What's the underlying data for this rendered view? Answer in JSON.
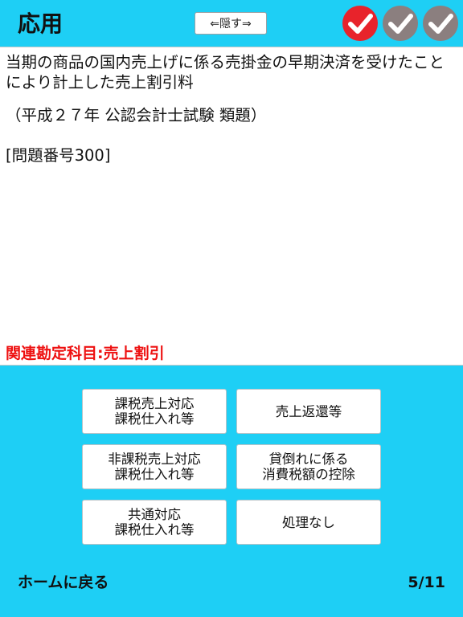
{
  "header": {
    "title": "応用",
    "hide_button_label": "⇐隠す⇒",
    "status_marks": [
      {
        "icon": "check-icon",
        "state": "correct",
        "color": "#e8232b"
      },
      {
        "icon": "check-icon",
        "state": "unanswered",
        "color": "#8b7f7f"
      },
      {
        "icon": "check-icon",
        "state": "unanswered",
        "color": "#8b7f7f"
      }
    ]
  },
  "question": {
    "text": "当期の商品の国内売上げに係る売掛金の早期決済を受けたことにより計上した売上割引料",
    "source": "（平成２７年 公認会計士試験 類題）",
    "number": "[問題番号300]",
    "related_subject": "関連勘定科目:売上割引",
    "related_color": "#ee1111"
  },
  "answers": [
    "課税売上対応\n課税仕入れ等",
    "売上返還等",
    "非課税売上対応\n課税仕入れ等",
    "貸倒れに係る\n消費税額の控除",
    "共通対応\n課税仕入れ等",
    "処理なし"
  ],
  "footer": {
    "home_label": "ホームに戻る",
    "page_counter": "5/11"
  },
  "colors": {
    "background": "#1ecff5"
  }
}
